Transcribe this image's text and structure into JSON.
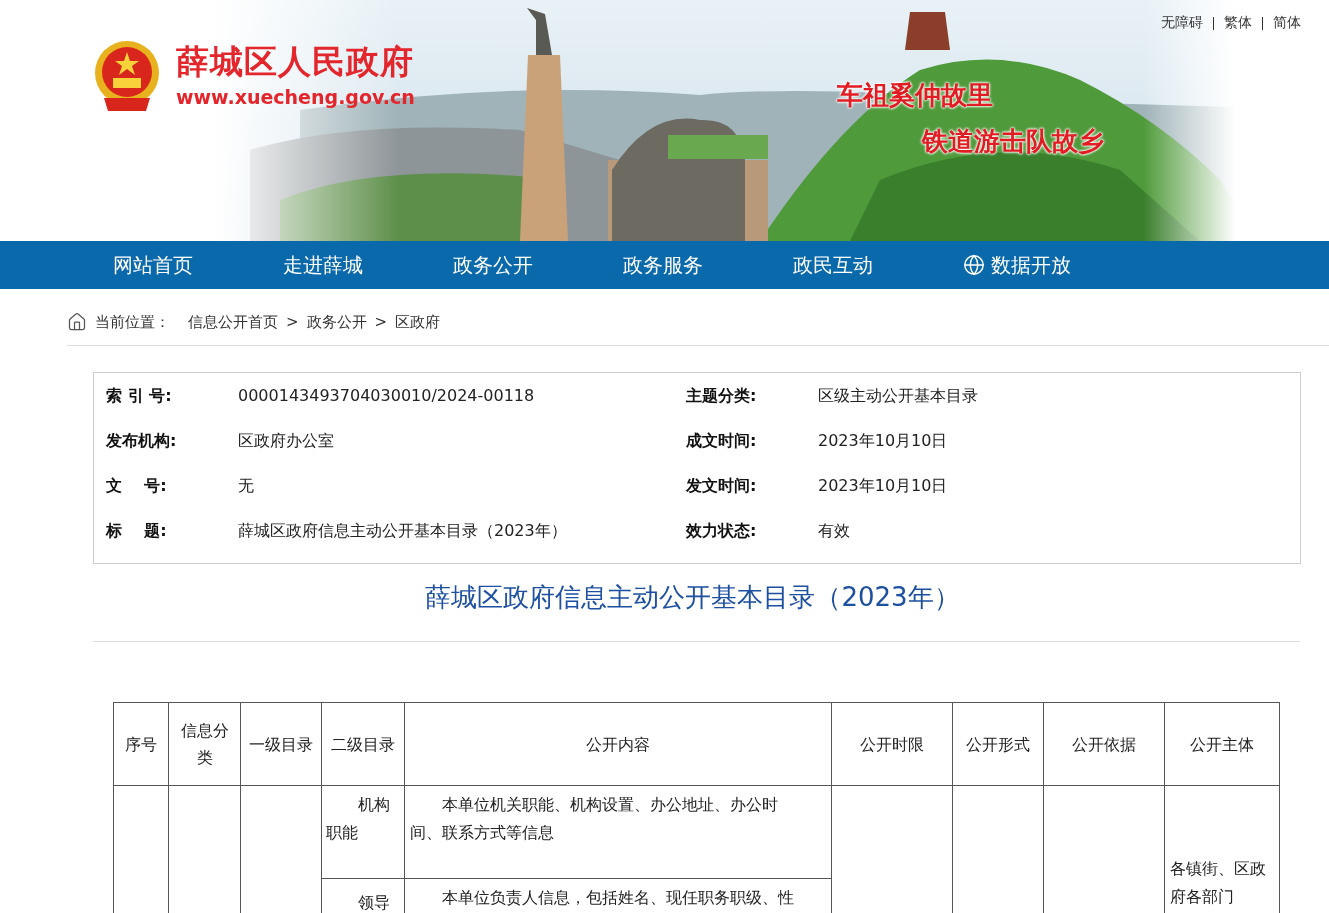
{
  "header": {
    "site_name": "薛城区人民政府",
    "site_url": "www.xuecheng.gov.cn",
    "slogans": [
      "车祖奚仲故里",
      "铁道游击队故乡"
    ],
    "top_links": [
      "无障碍",
      "繁体",
      "简体"
    ]
  },
  "nav": [
    {
      "label": "网站首页",
      "kind": "plain"
    },
    {
      "label": "走进薛城",
      "kind": "plain"
    },
    {
      "label": "政务公开",
      "kind": "plain"
    },
    {
      "label": "政务服务",
      "kind": "plain"
    },
    {
      "label": "政民互动",
      "kind": "plain"
    },
    {
      "label": "数据开放",
      "kind": "globe"
    }
  ],
  "breadcrumb": {
    "label": "当前位置：",
    "items": [
      "信息公开首页",
      "政务公开",
      "区政府"
    ],
    "separators": [
      ">",
      ">"
    ]
  },
  "info": [
    {
      "label": "索 引 号:",
      "value": "0000143493704030010/2024-00118"
    },
    {
      "label": "主题分类:",
      "value": "区级主动公开基本目录"
    },
    {
      "label": "发布机构:",
      "value": "区政府办公室"
    },
    {
      "label": "成文时间:",
      "value": "2023年10月10日"
    },
    {
      "label": "文    号:",
      "value": "无"
    },
    {
      "label": "发文时间:",
      "value": "2023年10月10日"
    },
    {
      "label": "标    题:",
      "value": "薛城区政府信息主动公开基本目录（2023年）"
    },
    {
      "label": "效力状态:",
      "value": "有效"
    }
  ],
  "title": "薛城区政府信息主动公开基本目录（2023年）",
  "table": {
    "columns": [
      "序号",
      "信息分类",
      "一级目录",
      "二级目录",
      "公开内容",
      "公开时限",
      "公开形式",
      "公开依据",
      "公开主体"
    ],
    "rows": [
      {
        "level2": "机构职能",
        "content": "本单位机关职能、机构设置、办公地址、办公时间、联系方式等信息"
      },
      {
        "level2": "领导",
        "content": "本单位负责人信息，包括姓名、现任职务职级、性"
      }
    ],
    "subject": "各镇街、区政府各部门"
  }
}
